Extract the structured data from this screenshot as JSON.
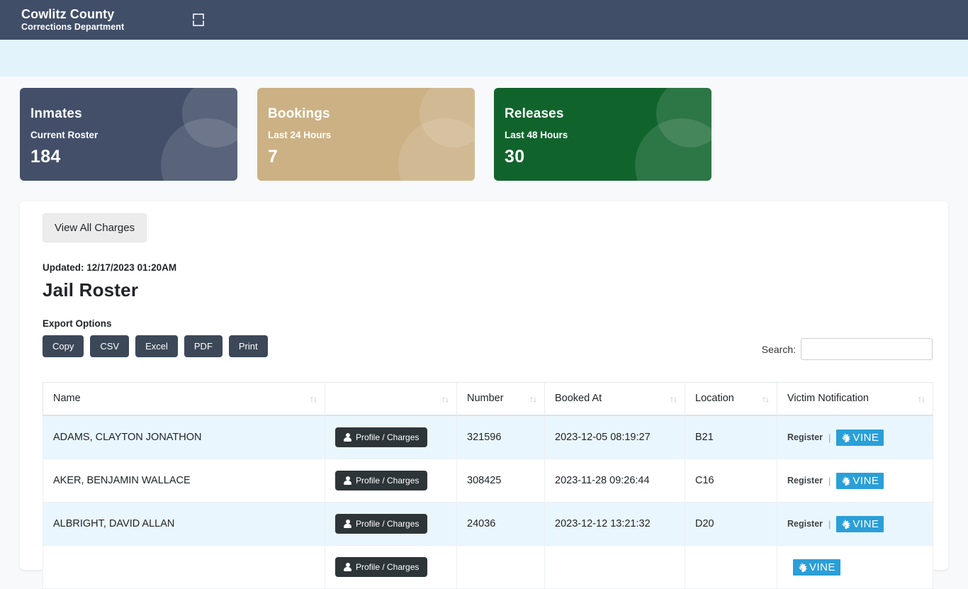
{
  "header": {
    "title": "Cowlitz County",
    "subtitle": "Corrections Department",
    "fullscreen_icon": "fullscreen-expand-icon"
  },
  "cards": [
    {
      "title": "Inmates",
      "subtitle": "Current Roster",
      "value": "184",
      "color": "#434f69"
    },
    {
      "title": "Bookings",
      "subtitle": "Last 24 Hours",
      "value": "7",
      "color": "#cbb184"
    },
    {
      "title": "Releases",
      "subtitle": "Last 48 Hours",
      "value": "30",
      "color": "#11632c"
    }
  ],
  "panel": {
    "view_all_charges": "View All Charges",
    "updated": "Updated: 12/17/2023 01:20AM",
    "page_title": "Jail Roster",
    "export_label": "Export Options",
    "export_buttons": [
      "Copy",
      "CSV",
      "Excel",
      "PDF",
      "Print"
    ],
    "search_label": "Search:",
    "search_value": "",
    "search_placeholder": ""
  },
  "table": {
    "columns": [
      "Name",
      "",
      "Number",
      "Booked At",
      "Location",
      "Victim Notification"
    ],
    "sort_icon": "sort-updown-icon",
    "profile_button_label": "Profile / Charges",
    "register_label": "Register",
    "separator": "|",
    "vine_label": "VINE",
    "rows": [
      {
        "name": "ADAMS, CLAYTON JONATHON",
        "action": "Profile / Charges",
        "number": "321596",
        "booked_at": "2023-12-05 08:19:27",
        "location": "B21",
        "victim_notification": "Register"
      },
      {
        "name": "AKER, BENJAMIN WALLACE",
        "action": "Profile / Charges",
        "number": "308425",
        "booked_at": "2023-11-28 09:26:44",
        "location": "C16",
        "victim_notification": "Register"
      },
      {
        "name": "ALBRIGHT, DAVID ALLAN",
        "action": "Profile / Charges",
        "number": "24036",
        "booked_at": "2023-12-12 13:21:32",
        "location": "D20",
        "victim_notification": "Register"
      },
      {
        "name": "",
        "action": "Profile / Charges",
        "number": "",
        "booked_at": "",
        "location": "",
        "victim_notification": ""
      }
    ]
  }
}
